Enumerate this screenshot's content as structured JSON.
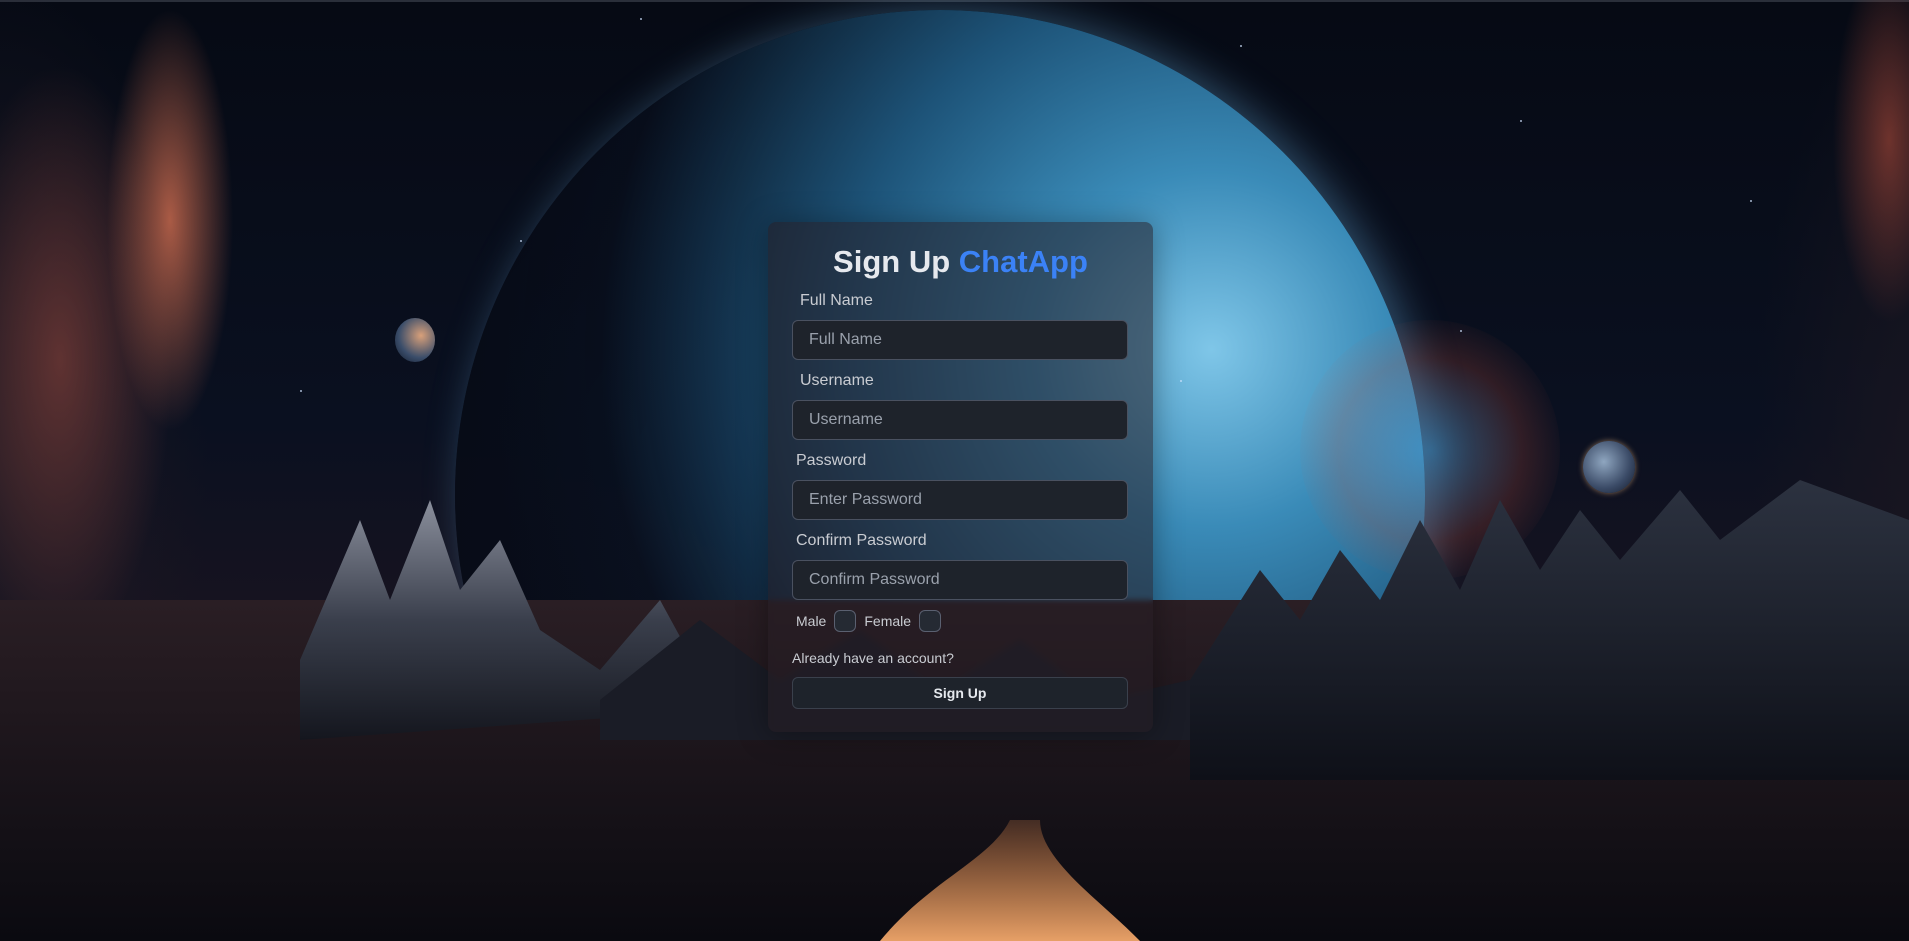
{
  "form": {
    "title": "Sign Up",
    "brand": "ChatApp",
    "fields": [
      {
        "label": "Full Name",
        "placeholder": "Full Name",
        "value": ""
      },
      {
        "label": "Username",
        "placeholder": "Username",
        "value": ""
      },
      {
        "label": "Password",
        "placeholder": "Enter Password",
        "value": ""
      },
      {
        "label": "Confirm Password",
        "placeholder": "Confirm Password",
        "value": ""
      }
    ],
    "gender": {
      "male_label": "Male",
      "female_label": "Female"
    },
    "login_link": "Already have an account?",
    "submit_label": "Sign Up"
  },
  "colors": {
    "brand": "#3b82f6",
    "card_bg": "#261e24",
    "input_bg": "#1e232b"
  }
}
